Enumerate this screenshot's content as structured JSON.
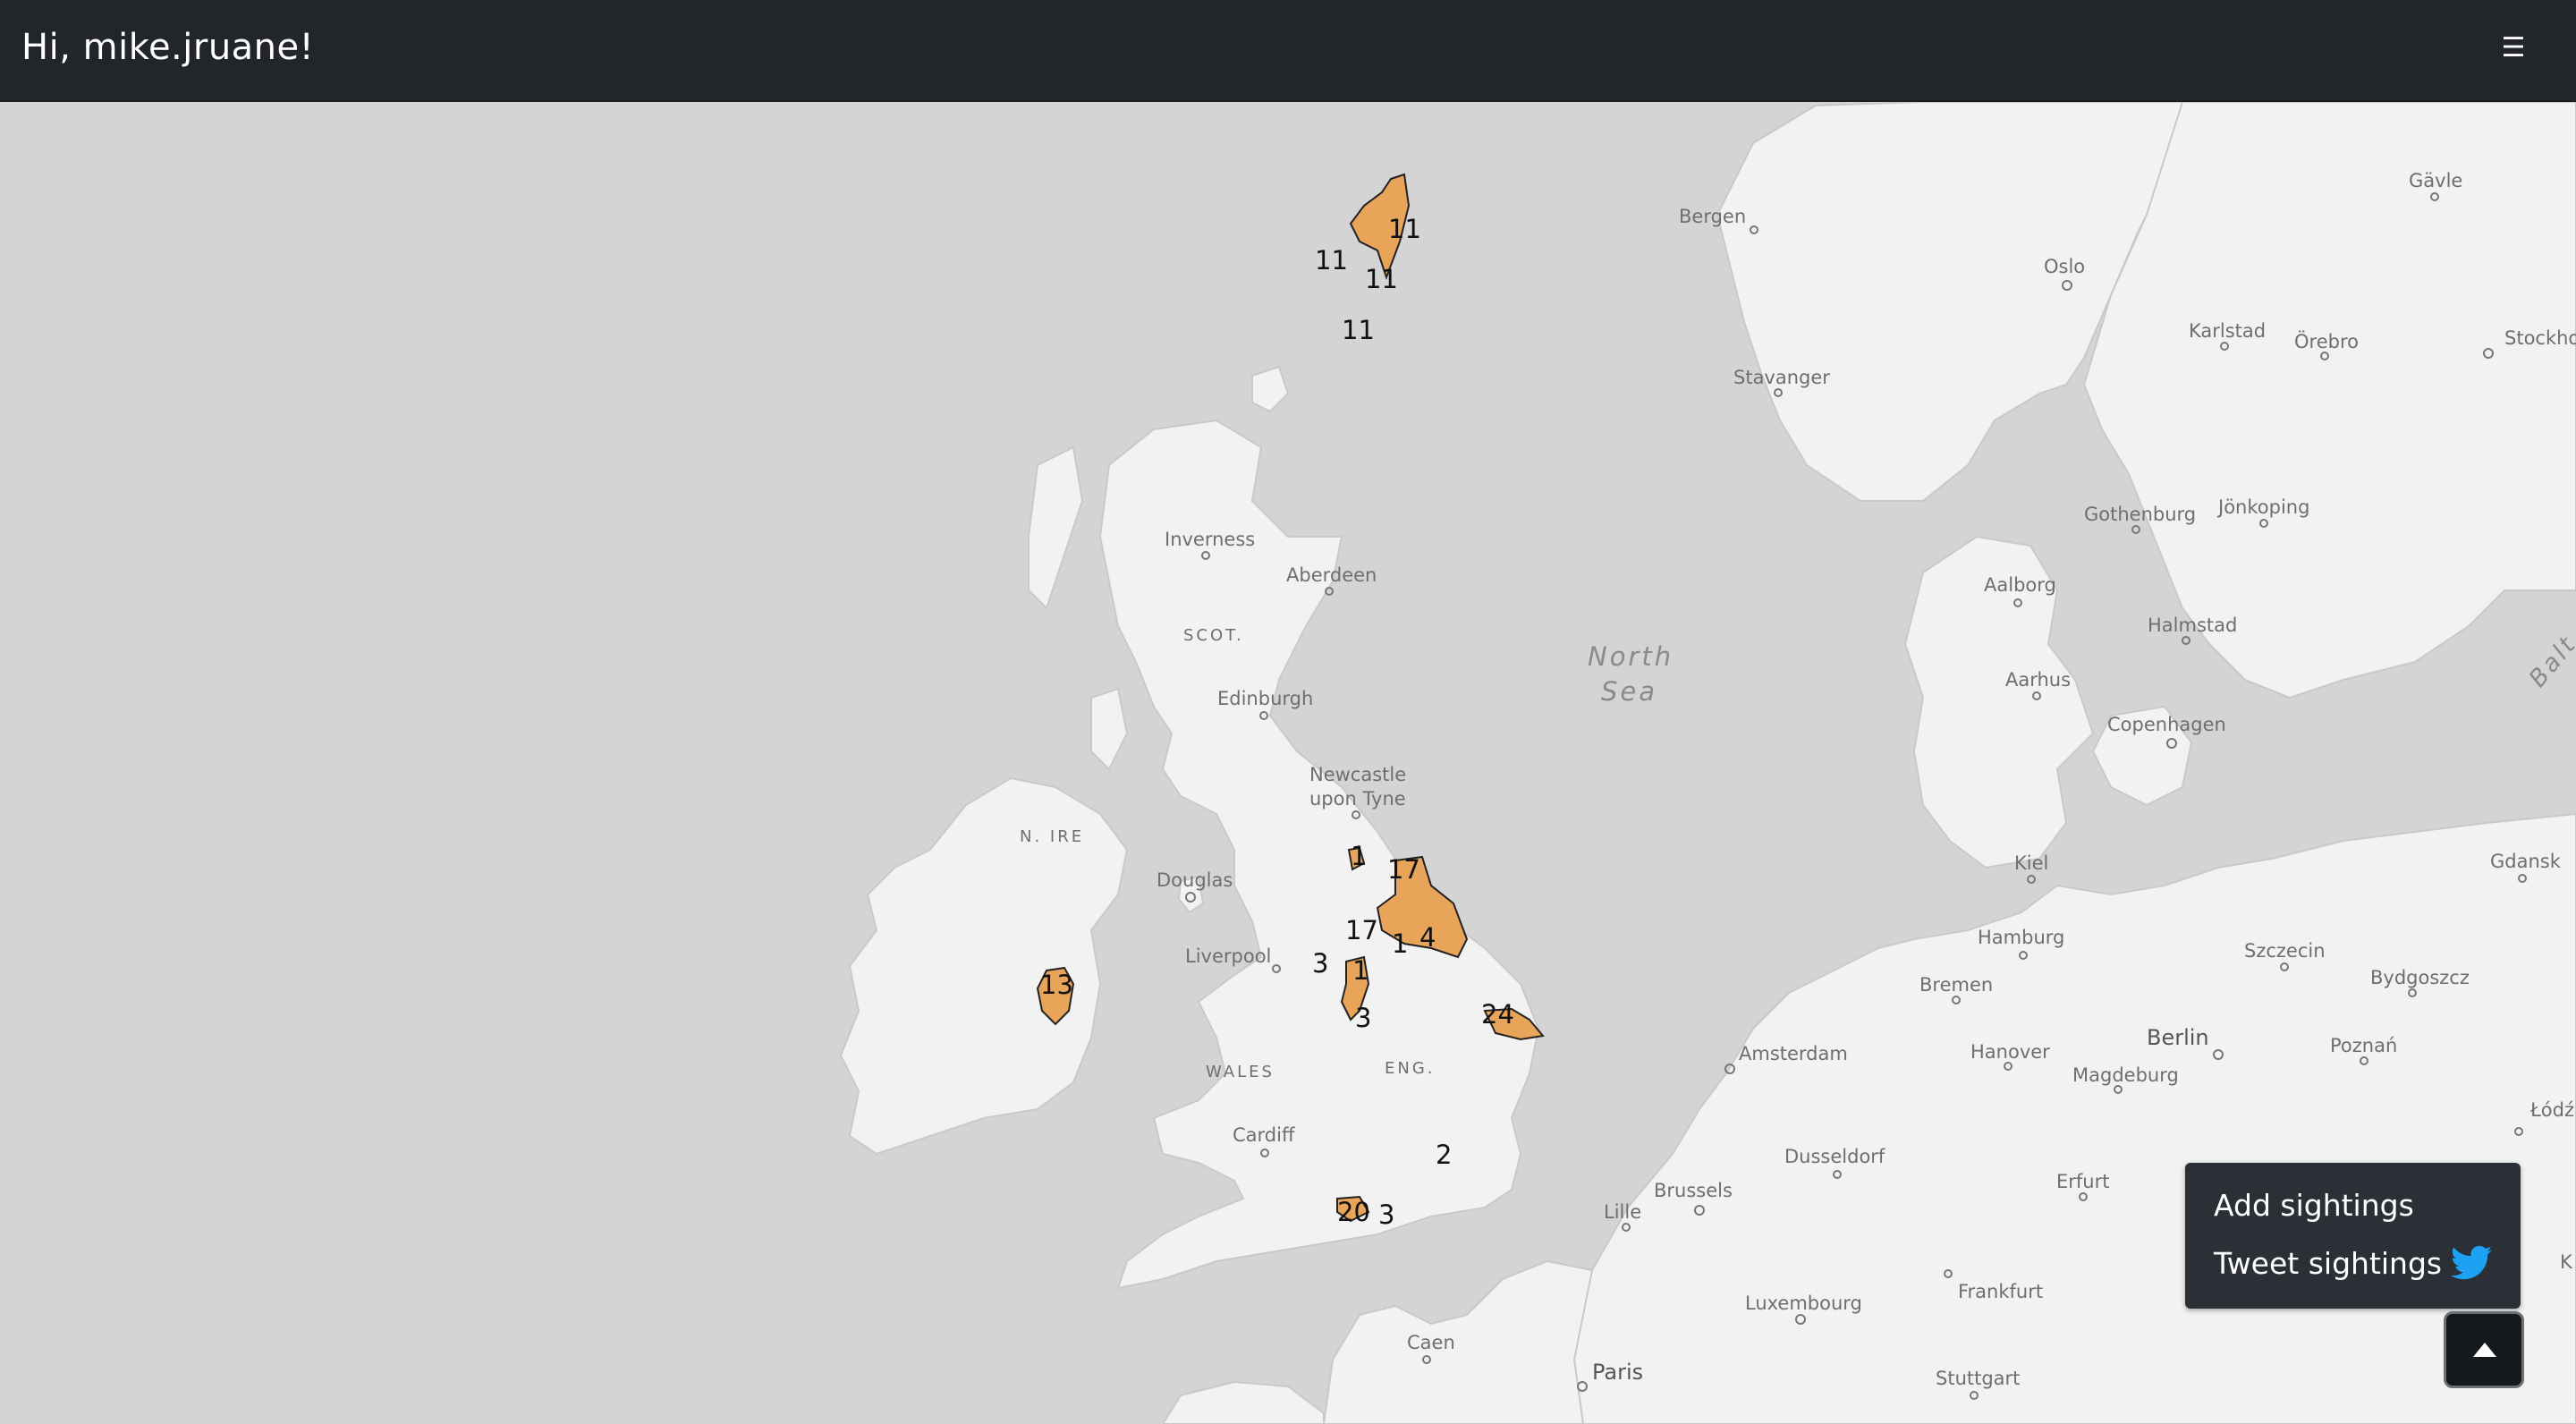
{
  "header": {
    "greeting": "Hi, mike.jruane!",
    "menu_icon": "hamburger-icon"
  },
  "colors": {
    "navbar": "#22262b",
    "sea": "#d4d4d4",
    "land": "#f2f2f2",
    "sighting_fill": "#e8a55a",
    "twitter": "#1da1f2"
  },
  "map": {
    "places": [
      {
        "id": "bergen",
        "label": "Bergen"
      },
      {
        "id": "oslo",
        "label": "Oslo"
      },
      {
        "id": "gavle",
        "label": "Gävle"
      },
      {
        "id": "stockholm",
        "label": "Stockho"
      },
      {
        "id": "karlstad",
        "label": "Karlstad"
      },
      {
        "id": "orebro",
        "label": "Örebro"
      },
      {
        "id": "stavanger",
        "label": "Stavanger"
      },
      {
        "id": "gothenburg",
        "label": "Gothenburg"
      },
      {
        "id": "jonkoping",
        "label": "Jönkoping"
      },
      {
        "id": "inverness",
        "label": "Inverness"
      },
      {
        "id": "aberdeen",
        "label": "Aberdeen"
      },
      {
        "id": "scot",
        "label": "SCOT."
      },
      {
        "id": "north-sea-1",
        "label": "North"
      },
      {
        "id": "north-sea-2",
        "label": "Sea"
      },
      {
        "id": "aalborg",
        "label": "Aalborg"
      },
      {
        "id": "halmstad",
        "label": "Halmstad"
      },
      {
        "id": "baltic",
        "label": "Balt"
      },
      {
        "id": "aarhus",
        "label": "Aarhus"
      },
      {
        "id": "edinburgh",
        "label": "Edinburgh"
      },
      {
        "id": "copenhagen",
        "label": "Copenhagen"
      },
      {
        "id": "newcastle-1",
        "label": "Newcastle"
      },
      {
        "id": "newcastle-2",
        "label": "upon Tyne"
      },
      {
        "id": "nire",
        "label": "N. IRE"
      },
      {
        "id": "kiel",
        "label": "Kiel"
      },
      {
        "id": "gdansk",
        "label": "Gdansk"
      },
      {
        "id": "douglas",
        "label": "Douglas"
      },
      {
        "id": "hamburg",
        "label": "Hamburg"
      },
      {
        "id": "szczecin",
        "label": "Szczecin"
      },
      {
        "id": "liverpool",
        "label": "Liverpool"
      },
      {
        "id": "bremen",
        "label": "Bremen"
      },
      {
        "id": "bydgoszcz",
        "label": "Bydgoszcz"
      },
      {
        "id": "berlin",
        "label": "Berlin"
      },
      {
        "id": "hanover",
        "label": "Hanover"
      },
      {
        "id": "amsterdam",
        "label": "Amsterdam"
      },
      {
        "id": "poznan",
        "label": "Poznań"
      },
      {
        "id": "magdeburg",
        "label": "Magdeburg"
      },
      {
        "id": "lodz",
        "label": "Łódź"
      },
      {
        "id": "wales",
        "label": "WALES"
      },
      {
        "id": "eng",
        "label": "ENG."
      },
      {
        "id": "cardiff",
        "label": "Cardiff"
      },
      {
        "id": "dusseldorf",
        "label": "Dusseldorf"
      },
      {
        "id": "brussels",
        "label": "Brussels"
      },
      {
        "id": "erfurt",
        "label": "Erfurt"
      },
      {
        "id": "lille",
        "label": "Lille"
      },
      {
        "id": "luxembourg",
        "label": "Luxembourg"
      },
      {
        "id": "frankfurt",
        "label": "Frankfurt"
      },
      {
        "id": "caen",
        "label": "Caen"
      },
      {
        "id": "paris",
        "label": "Paris"
      },
      {
        "id": "stuttgart",
        "label": "Stuttgart"
      },
      {
        "id": "k-edge",
        "label": "K"
      }
    ],
    "sighting_counts": [
      {
        "id": "shetland-a",
        "count": "11"
      },
      {
        "id": "shetland-b",
        "count": "11"
      },
      {
        "id": "shetland-c",
        "count": "11"
      },
      {
        "id": "fair-isle",
        "count": "11"
      },
      {
        "id": "tees",
        "count": "1"
      },
      {
        "id": "yorks-coast",
        "count": "17"
      },
      {
        "id": "yorks-dales",
        "count": "17"
      },
      {
        "id": "yorks-east",
        "count": "4"
      },
      {
        "id": "yorks-mid",
        "count": "1"
      },
      {
        "id": "lancs-a",
        "count": "3"
      },
      {
        "id": "lancs-b",
        "count": "1"
      },
      {
        "id": "peak",
        "count": "3"
      },
      {
        "id": "ireland",
        "count": "13"
      },
      {
        "id": "norfolk",
        "count": "24"
      },
      {
        "id": "london",
        "count": "2"
      },
      {
        "id": "dorset",
        "count": "20"
      },
      {
        "id": "hants",
        "count": "3"
      }
    ]
  },
  "panel": {
    "add_label": "Add sightings",
    "tweet_label": "Tweet sightings",
    "tweet_icon": "twitter-bird-icon",
    "toggle_icon": "caret-up-icon"
  }
}
